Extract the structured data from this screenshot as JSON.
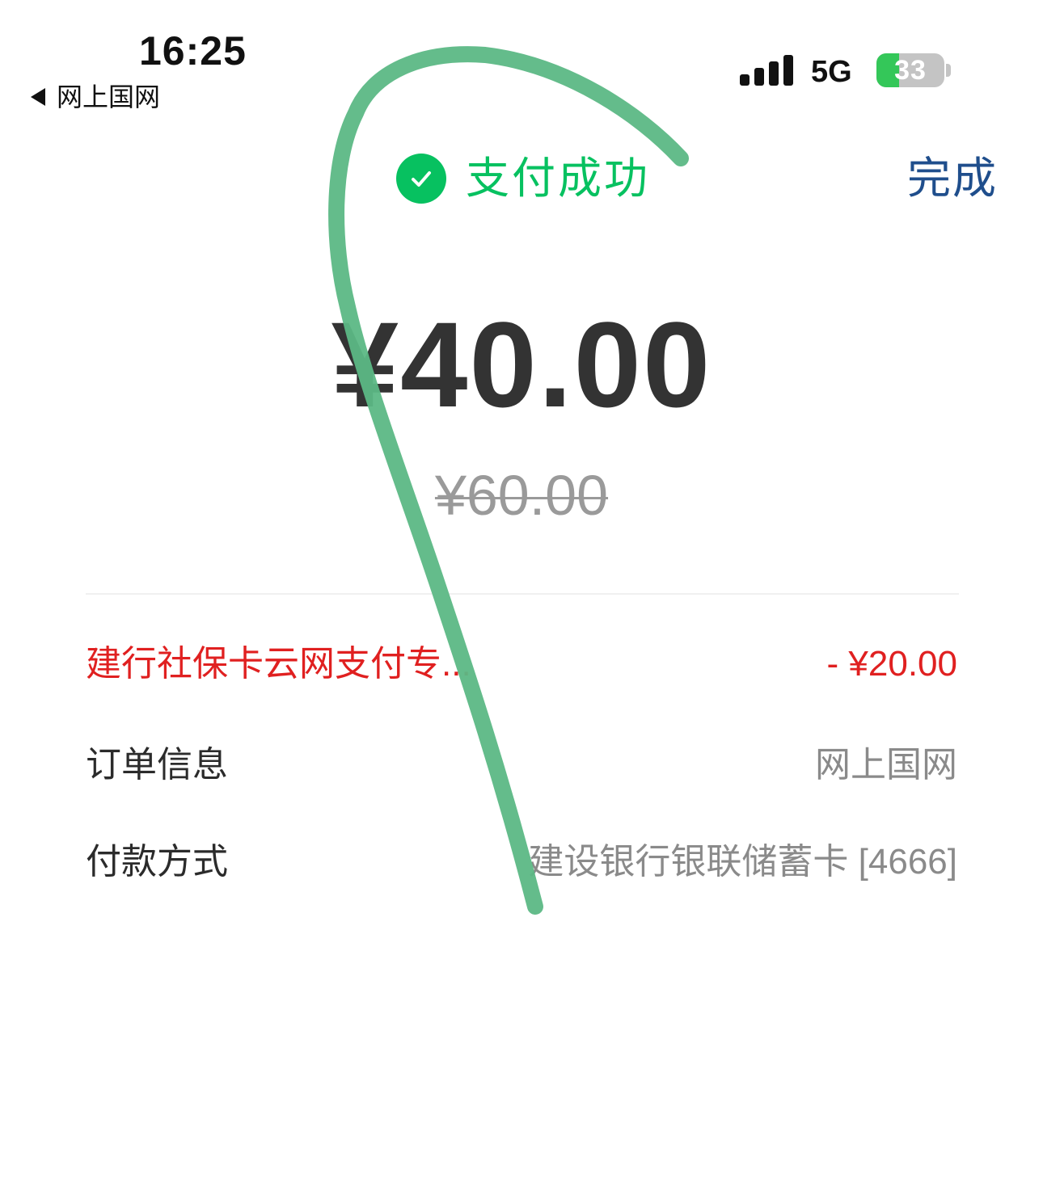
{
  "status_bar": {
    "time": "16:25",
    "back_app": "网上国网",
    "network": "5G",
    "battery": "33",
    "battery_level_percent": 33,
    "signal_bars": 4
  },
  "header": {
    "success_text": "支付成功",
    "done_label": "完成"
  },
  "payment": {
    "amount": "¥40.00",
    "original_amount": "¥60.00"
  },
  "details": {
    "discount": {
      "label": "建行社保卡云网支付专...",
      "value": "- ¥20.00"
    },
    "order": {
      "label": "订单信息",
      "value": "网上国网"
    },
    "method": {
      "label": "付款方式",
      "value": "建设银行银联储蓄卡 [4666]"
    }
  },
  "colors": {
    "success_green": "#07c160",
    "done_blue": "#1f4e8c",
    "discount_red": "#e02020",
    "scribble_green": "#5cb885"
  }
}
